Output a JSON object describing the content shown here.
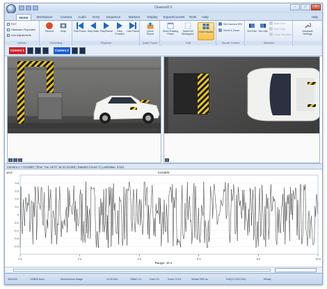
{
  "window": {
    "title": "Dewesoft X"
  },
  "tabs": [
    "Home",
    "Workspace",
    "Camera",
    "Audio",
    "DAQ",
    "Sequence",
    "Markers",
    "Display",
    "Export/Convert",
    "Tools",
    "Help"
  ],
  "help_menu": "Help",
  "ribbon": {
    "groups": {
      "options": "Options",
      "recording": "Recording",
      "playback": "Playback",
      "quick_export": "Quick Export",
      "grid": "Grid",
      "mouse_control": "Mouse Control",
      "selection": "Selection",
      "settings": ""
    },
    "options": [
      "ROT",
      "Hardware Properties",
      "Live Adjustments"
    ],
    "buttons": {
      "record": "Record",
      "snap": "Snap",
      "first_frame": "First Frame",
      "step_back": "Step Back",
      "play_pause": "Play/Pause",
      "step_forward": "Step Forward",
      "last_frame": "Last Frame",
      "quick_export": "Quick Export",
      "show_existing_panel": "Show Existing Panel",
      "select_all_workspace": "Select All Workspace",
      "multi_display": "Multi Display",
      "set_first": "Set First",
      "set_last": "Set Last",
      "dewesoft_settings": "Dewesoft Settings"
    },
    "mouse_control": [
      "Set Camera ROI",
      "Scroll & Zoom"
    ],
    "selection": [
      "Auto First",
      "Auto Last",
      "Clear Selection"
    ]
  },
  "camera_tabs": [
    "Camera 1",
    "Camera 2"
  ],
  "info_bar": "Camera 1 > CH1800 | Time: Tue Jul 07 15:31:34.863 | DataSet Count: 0 | LastValue: 3.541",
  "chart_data": {
    "type": "line",
    "title": "CH1800",
    "corner_value": "10.0",
    "y_ticks": [
      "0.4",
      "0.3",
      "0.2",
      "0.1",
      "0",
      "-0.1",
      "-0.2",
      "-0.3",
      "-0.4"
    ],
    "y_range": [
      -0.5,
      0.5
    ],
    "x_ticks": [
      "0 s",
      "2 s",
      "4 s",
      "6 s",
      "8 s",
      "10 s"
    ],
    "x_range": [
      0,
      10
    ],
    "range_label": "Range: 10 s",
    "series_color": "#1a1a1a",
    "samples": 400
  },
  "status": [
    "320x240",
    "133830 fps/s",
    "Monochrome image",
    "12.00 kHz",
    "Offset: 0.0",
    "Gain 0.0",
    "Zoom: 0.0%",
    "Shutter 500 us",
    "ROI(0,0,319,239)",
    "Ready"
  ],
  "colors": {
    "accent": "#1f68c7",
    "camera1": "#c9252b",
    "camera2": "#1f5fd1"
  }
}
